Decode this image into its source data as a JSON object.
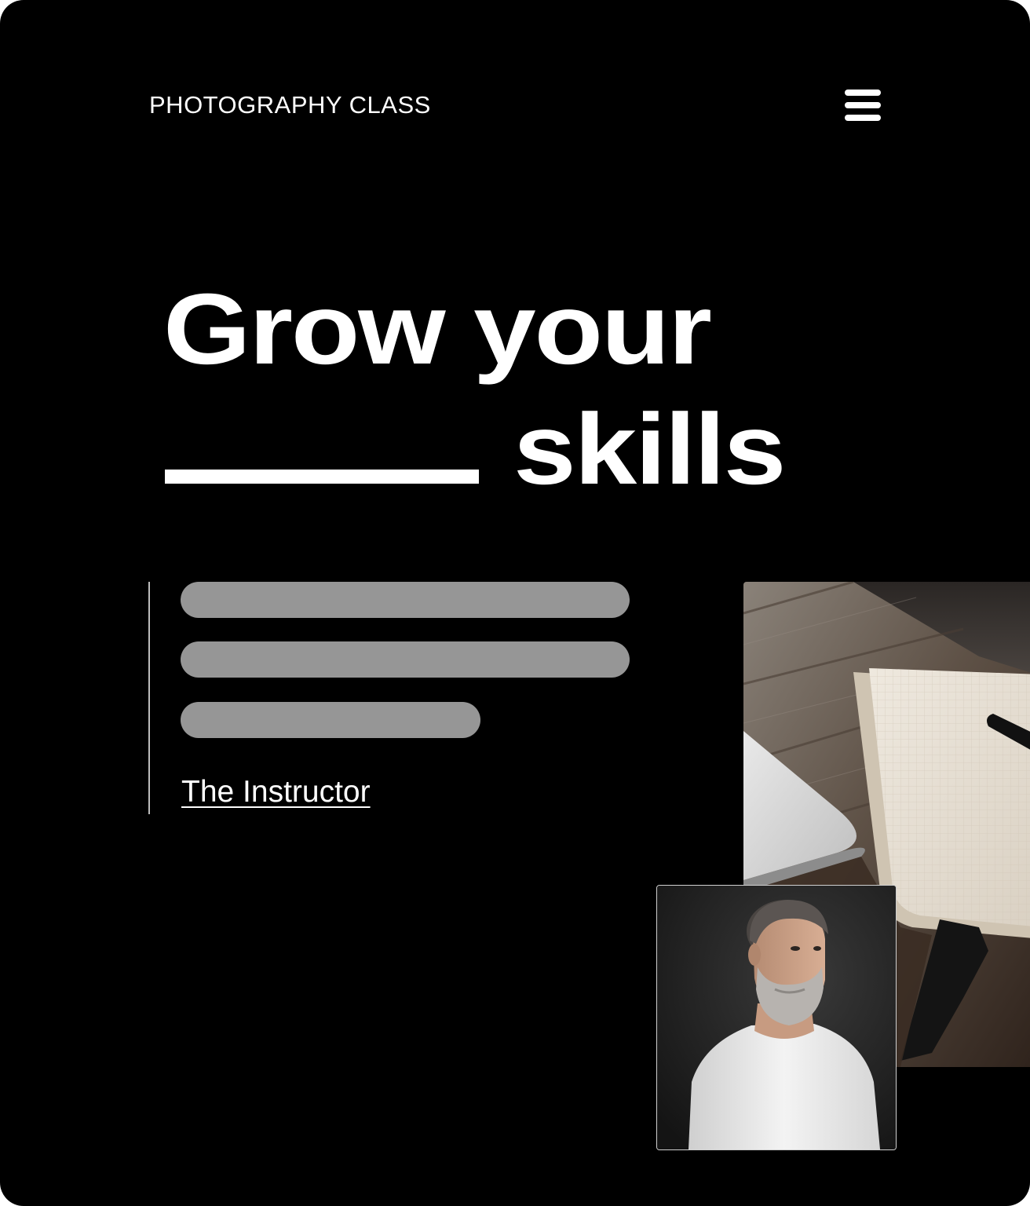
{
  "header": {
    "brand": "PHOTOGRAPHY CLASS",
    "menu_icon": "hamburger-menu-icon"
  },
  "hero": {
    "headline_line1": "Grow your",
    "headline_line2": "skills"
  },
  "intro": {
    "instructor_link": "The Instructor"
  },
  "images": {
    "desk_photo": "desk-with-notebook-laptop-pen-photo",
    "portrait_photo": "bearded-man-white-tshirt-portrait-photo"
  },
  "colors": {
    "background": "#000000",
    "text": "#ffffff",
    "placeholder": "#969696"
  }
}
